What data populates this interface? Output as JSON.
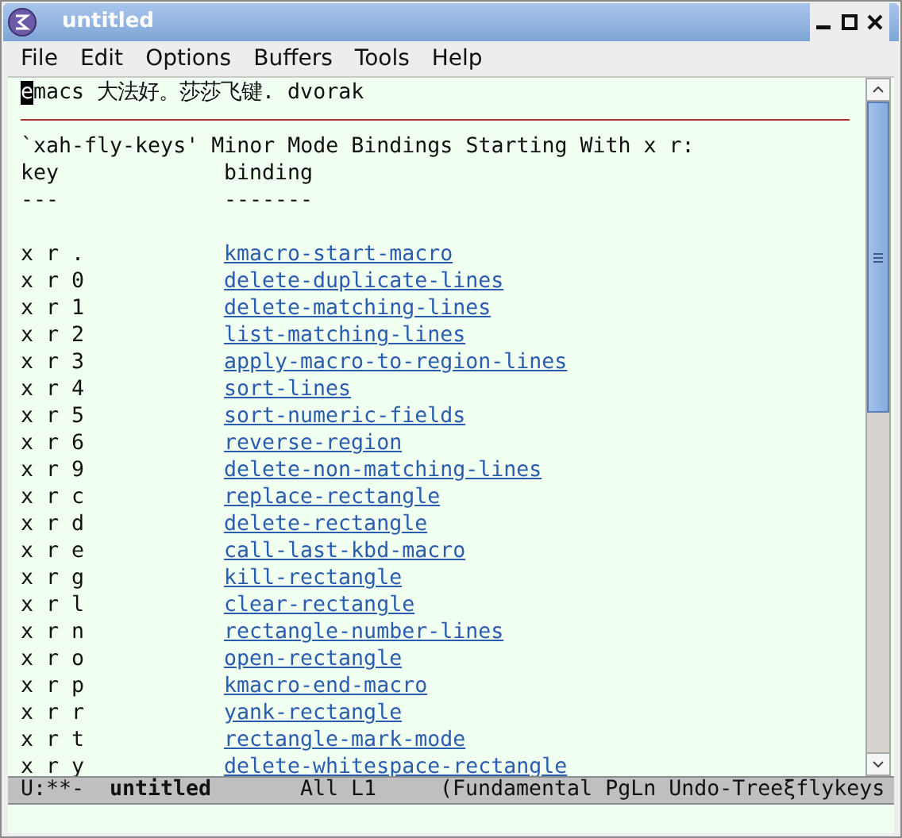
{
  "window": {
    "title": "untitled"
  },
  "menu": [
    "File",
    "Edit",
    "Options",
    "Buffers",
    "Tools",
    "Help"
  ],
  "first_line": {
    "cursor": "e",
    "rest": "macs 大法好。莎莎飞键. dvorak"
  },
  "heading": "`xah-fly-keys' Minor Mode Bindings Starting With x r:",
  "columns": [
    {
      "label": "key",
      "rule": "---"
    },
    {
      "label": "binding",
      "rule": "-------"
    }
  ],
  "rows": [
    {
      "key": "x r .",
      "binding": "kmacro-start-macro"
    },
    {
      "key": "x r 0",
      "binding": "delete-duplicate-lines"
    },
    {
      "key": "x r 1",
      "binding": "delete-matching-lines"
    },
    {
      "key": "x r 2",
      "binding": "list-matching-lines"
    },
    {
      "key": "x r 3",
      "binding": "apply-macro-to-region-lines"
    },
    {
      "key": "x r 4",
      "binding": "sort-lines"
    },
    {
      "key": "x r 5",
      "binding": "sort-numeric-fields"
    },
    {
      "key": "x r 6",
      "binding": "reverse-region"
    },
    {
      "key": "x r 9",
      "binding": "delete-non-matching-lines"
    },
    {
      "key": "x r c",
      "binding": "replace-rectangle"
    },
    {
      "key": "x r d",
      "binding": "delete-rectangle"
    },
    {
      "key": "x r e",
      "binding": "call-last-kbd-macro"
    },
    {
      "key": "x r g",
      "binding": "kill-rectangle"
    },
    {
      "key": "x r l",
      "binding": "clear-rectangle"
    },
    {
      "key": "x r n",
      "binding": "rectangle-number-lines"
    },
    {
      "key": "x r o",
      "binding": "open-rectangle"
    },
    {
      "key": "x r p",
      "binding": "kmacro-end-macro"
    },
    {
      "key": "x r r",
      "binding": "yank-rectangle"
    },
    {
      "key": "x r t",
      "binding": "rectangle-mark-mode"
    },
    {
      "key": "x r y",
      "binding": "delete-whitespace-rectangle"
    }
  ],
  "mode_line": {
    "status": "U:**-",
    "buffer": "untitled",
    "position": "All",
    "line": "L1",
    "modes": "(Fundamental PgLn Undo-Treeξflykeys"
  }
}
